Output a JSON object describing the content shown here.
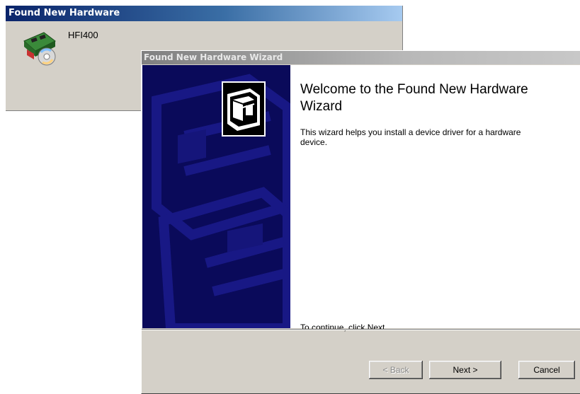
{
  "background_window": {
    "title": "Found New Hardware",
    "device_name": "HFI400"
  },
  "wizard": {
    "title": "Found New Hardware Wizard",
    "heading": "Welcome to the Found New Hardware Wizard",
    "description": "This wizard helps you install a device driver for a hardware device.",
    "continue_text": "To continue, click Next.",
    "buttons": {
      "back": "< Back",
      "next": "Next >",
      "cancel": "Cancel"
    }
  },
  "colors": {
    "side_panel": "#0a0a5a",
    "title_active": "#0a246a",
    "title_inactive": "#808080",
    "dialog_face": "#d4d0c8"
  },
  "icons": {
    "hardware": "hardware-card-icon",
    "wizard": "hardware-box-icon"
  }
}
